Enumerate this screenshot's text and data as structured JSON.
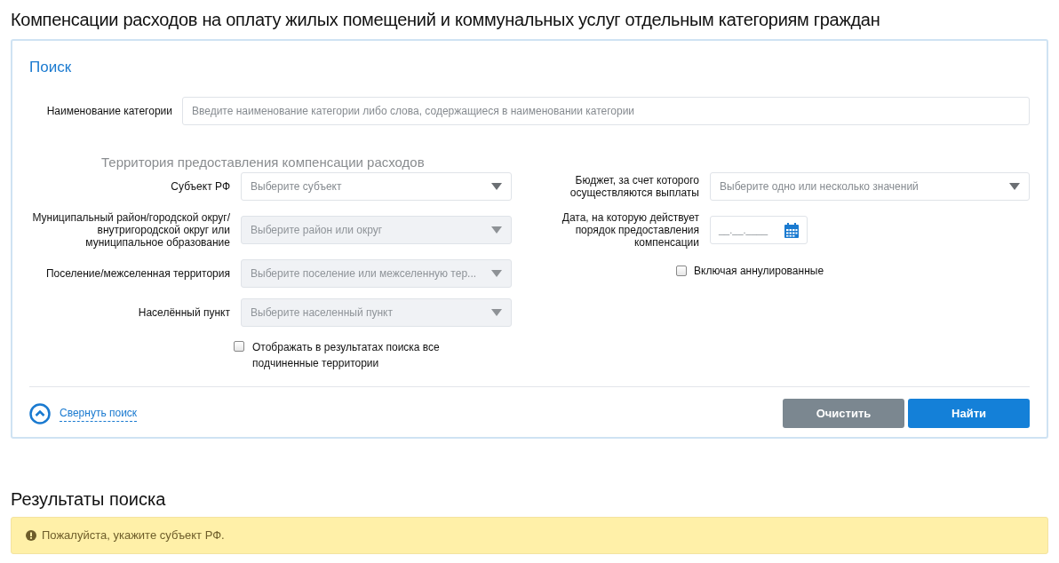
{
  "title": "Компенсации расходов на оплату жилых помещений и коммунальных услуг отдельным категориям граждан",
  "search": {
    "title": "Поиск",
    "category": {
      "label": "Наименование категории",
      "placeholder": "Введите наименование категории либо слова, содержащиеся в наименовании категории"
    },
    "territory": {
      "heading": "Территория предоставления компенсации расходов",
      "fields": [
        {
          "label": "Субъект РФ",
          "placeholder": "Выберите субъект",
          "disabled": false
        },
        {
          "label": "Муниципальный район/городской округ/внутригородской округ или муниципальное образование",
          "placeholder": "Выберите район или округ",
          "disabled": true
        },
        {
          "label": "Поселение/межселенная территория",
          "placeholder": "Выберите поселение или межселенную тер...",
          "disabled": true
        },
        {
          "label": "Населённый пункт",
          "placeholder": "Выберите населенный пункт",
          "disabled": true
        }
      ],
      "checkbox": {
        "label": "Отображать в результатах поиска все подчиненные территории",
        "checked": false
      }
    },
    "budget": {
      "label": "Бюджет, за счет которого осуществляются выплаты",
      "placeholder": "Выберите одно или несколько значений"
    },
    "date": {
      "label": "Дата, на которую действует порядок предоставления компенсации",
      "placeholder": "__.__.____"
    },
    "annulled": {
      "label": "Включая аннулированные",
      "checked": false
    },
    "collapse_link": "Свернуть поиск",
    "buttons": [
      {
        "label": "Очистить",
        "kind": "secondary"
      },
      {
        "label": "Найти",
        "kind": "primary"
      }
    ]
  },
  "results": {
    "title": "Результаты поиска",
    "alert": "Пожалуйста, укажите субъект РФ."
  }
}
